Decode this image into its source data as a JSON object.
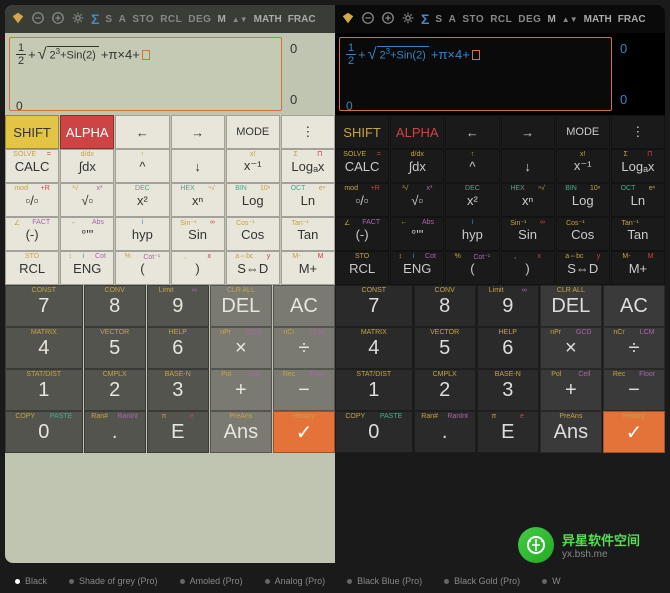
{
  "topbar": {
    "indicator_s": "S",
    "indicator_a": "A",
    "sto": "STO",
    "rcl": "RCL",
    "deg": "DEG",
    "m": "M",
    "math": "MATH",
    "frac": "FRAC"
  },
  "display": {
    "formula_parts": {
      "half_num": "1",
      "half_den": "2",
      "plus1": "+",
      "sqrt_inner": "2",
      "sqrt_exp": "3",
      "plus2": "+Sin(2)",
      "plus3": "+",
      "pi": "π",
      "times4": "×4+"
    },
    "right_top": "0",
    "right_bot": "0",
    "left_bot": "0"
  },
  "fnrows": [
    [
      {
        "main": "SHIFT",
        "cls": "shift",
        "sub": []
      },
      {
        "main": "ALPHA",
        "cls": "alpha",
        "sub": []
      },
      {
        "main": "←",
        "sub": []
      },
      {
        "main": "→",
        "sub": []
      },
      {
        "main": "MODE",
        "cls": "mode",
        "sub": []
      },
      {
        "main": "⋮",
        "sub": []
      }
    ],
    [
      {
        "main": "CALC",
        "sub": [
          {
            "t": "SOLVE",
            "c": "y"
          },
          {
            "t": "=",
            "c": "r"
          }
        ]
      },
      {
        "main": "∫dx",
        "sub": [
          {
            "t": "d/dx",
            "c": "y"
          }
        ]
      },
      {
        "main": "^",
        "sub": [
          {
            "t": "↑",
            "c": "y"
          }
        ]
      },
      {
        "main": "↓",
        "sub": [
          {
            "t": "",
            "c": ""
          }
        ]
      },
      {
        "main": "x⁻¹",
        "sub": [
          {
            "t": "x!",
            "c": "y"
          }
        ]
      },
      {
        "main": "Logₐx",
        "sub": [
          {
            "t": "Σ",
            "c": "y"
          },
          {
            "t": "Π",
            "c": "r"
          }
        ]
      }
    ],
    [
      {
        "main": "▫/▫",
        "sub": [
          {
            "t": "mod",
            "c": "y"
          },
          {
            "t": "+R",
            "c": "r"
          }
        ]
      },
      {
        "main": "√▫",
        "sub": [
          {
            "t": "³√",
            "c": "y"
          },
          {
            "t": "x³",
            "c": "p"
          }
        ]
      },
      {
        "main": "x²",
        "sub": [
          {
            "t": "DEC",
            "c": "g"
          }
        ]
      },
      {
        "main": "xⁿ",
        "sub": [
          {
            "t": "HEX",
            "c": "g"
          },
          {
            "t": "ⁿ√",
            "c": "y"
          }
        ]
      },
      {
        "main": "Log",
        "sub": [
          {
            "t": "BIN",
            "c": "g"
          },
          {
            "t": "10ⁿ",
            "c": "y"
          }
        ]
      },
      {
        "main": "Ln",
        "sub": [
          {
            "t": "OCT",
            "c": "g"
          },
          {
            "t": "eⁿ",
            "c": "y"
          }
        ]
      }
    ],
    [
      {
        "main": "(-)",
        "sub": [
          {
            "t": "∠",
            "c": "y"
          },
          {
            "t": "FACT",
            "c": "p"
          }
        ]
      },
      {
        "main": "°'\"",
        "sub": [
          {
            "t": "←",
            "c": "y"
          },
          {
            "t": "Abs",
            "c": "p"
          }
        ]
      },
      {
        "main": "hyp",
        "sub": [
          {
            "t": "i",
            "c": "b"
          }
        ]
      },
      {
        "main": "Sin",
        "sub": [
          {
            "t": "Sin⁻¹",
            "c": "y"
          },
          {
            "t": "∞",
            "c": "r"
          }
        ]
      },
      {
        "main": "Cos",
        "sub": [
          {
            "t": "Cos⁻¹",
            "c": "y"
          },
          {
            "t": "",
            "c": ""
          }
        ]
      },
      {
        "main": "Tan",
        "sub": [
          {
            "t": "Tan⁻¹",
            "c": "y"
          },
          {
            "t": "",
            "c": ""
          }
        ]
      }
    ],
    [
      {
        "main": "RCL",
        "sub": [
          {
            "t": "STO",
            "c": "y"
          }
        ]
      },
      {
        "main": "ENG",
        "sub": [
          {
            "t": "↕",
            "c": "y"
          },
          {
            "t": "i",
            "c": "b"
          },
          {
            "t": "Cot",
            "c": "p"
          }
        ]
      },
      {
        "main": "(",
        "sub": [
          {
            "t": "%",
            "c": "y"
          },
          {
            "t": "Cot⁻¹",
            "c": "p"
          }
        ]
      },
      {
        "main": ")",
        "sub": [
          {
            "t": ",",
            "c": "y"
          },
          {
            "t": "x",
            "c": "r"
          }
        ]
      },
      {
        "main": "S⇔D",
        "sub": [
          {
            "t": "a⇔bc",
            "c": "y"
          },
          {
            "t": "y",
            "c": "r"
          }
        ]
      },
      {
        "main": "M+",
        "sub": [
          {
            "t": "M-",
            "c": "y"
          },
          {
            "t": "M",
            "c": "r"
          }
        ]
      }
    ]
  ],
  "numrows": [
    [
      {
        "main": "7",
        "sub": [
          {
            "t": "CONST",
            "c": "y"
          }
        ]
      },
      {
        "main": "8",
        "sub": [
          {
            "t": "CONV",
            "c": "y"
          }
        ]
      },
      {
        "main": "9",
        "sub": [
          {
            "t": "Limit",
            "c": "y"
          },
          {
            "t": "∞",
            "c": "p"
          }
        ]
      },
      {
        "main": "DEL",
        "cls": "op",
        "sub": [
          {
            "t": "CLR ALL",
            "c": "y"
          }
        ]
      },
      {
        "main": "AC",
        "cls": "ac",
        "sub": []
      }
    ],
    [
      {
        "main": "4",
        "sub": [
          {
            "t": "MATRIX",
            "c": "y"
          }
        ]
      },
      {
        "main": "5",
        "sub": [
          {
            "t": "VECTOR",
            "c": "y"
          }
        ]
      },
      {
        "main": "6",
        "sub": [
          {
            "t": "HELP",
            "c": "y"
          }
        ]
      },
      {
        "main": "×",
        "cls": "op",
        "sub": [
          {
            "t": "nPr",
            "c": "y"
          },
          {
            "t": "GCD",
            "c": "p"
          }
        ]
      },
      {
        "main": "÷",
        "cls": "op",
        "sub": [
          {
            "t": "nCr",
            "c": "y"
          },
          {
            "t": "LCM",
            "c": "p"
          }
        ]
      }
    ],
    [
      {
        "main": "1",
        "sub": [
          {
            "t": "STAT/DIST",
            "c": "y"
          }
        ]
      },
      {
        "main": "2",
        "sub": [
          {
            "t": "CMPLX",
            "c": "y"
          }
        ]
      },
      {
        "main": "3",
        "sub": [
          {
            "t": "BASE-N",
            "c": "y"
          }
        ]
      },
      {
        "main": "+",
        "cls": "op",
        "sub": [
          {
            "t": "Pol",
            "c": "y"
          },
          {
            "t": "Ceil",
            "c": "p"
          }
        ]
      },
      {
        "main": "−",
        "cls": "op",
        "sub": [
          {
            "t": "Rec",
            "c": "y"
          },
          {
            "t": "Floor",
            "c": "p"
          }
        ]
      }
    ],
    [
      {
        "main": "0",
        "sub": [
          {
            "t": "COPY",
            "c": "y"
          },
          {
            "t": "PASTE",
            "c": "g"
          }
        ]
      },
      {
        "main": ".",
        "sub": [
          {
            "t": "Ran#",
            "c": "y"
          },
          {
            "t": "RanInt",
            "c": "p"
          }
        ]
      },
      {
        "main": "E",
        "sub": [
          {
            "t": "π",
            "c": "y"
          },
          {
            "t": "e",
            "c": "r"
          }
        ]
      },
      {
        "main": "Ans",
        "cls": "op",
        "sub": [
          {
            "t": "PreAns",
            "c": "y"
          }
        ]
      },
      {
        "main": "✓",
        "cls": "check",
        "sub": [
          {
            "t": "History",
            "c": "y"
          }
        ]
      }
    ]
  ],
  "bottombar": {
    "themes": [
      "Black",
      "Shade of grey (Pro)",
      "Amoled (Pro)",
      "Analog (Pro)",
      "Black Blue (Pro)",
      "Black Gold (Pro)",
      "W"
    ]
  },
  "watermark": {
    "cn": "异星软件空间",
    "url": "yx.bsh.me"
  }
}
